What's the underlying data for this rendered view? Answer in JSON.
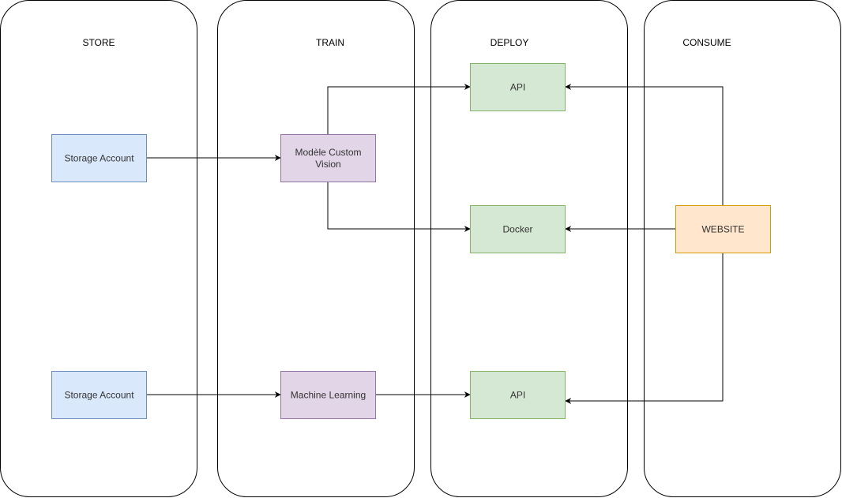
{
  "lanes": [
    {
      "id": "store",
      "label": "STORE"
    },
    {
      "id": "train",
      "label": "TRAIN"
    },
    {
      "id": "deploy",
      "label": "DEPLOY"
    },
    {
      "id": "consume",
      "label": "CONSUME"
    }
  ],
  "nodes": [
    {
      "id": "storage1",
      "label": [
        "Storage Account"
      ],
      "lane": "store",
      "fill": "#dae8fc",
      "stroke": "#6c8ebf"
    },
    {
      "id": "customvision",
      "label": [
        "Modèle Custom",
        "Vision"
      ],
      "lane": "train",
      "fill": "#e1d5e7",
      "stroke": "#9673a6"
    },
    {
      "id": "api1",
      "label": [
        "API"
      ],
      "lane": "deploy",
      "fill": "#d5e8d4",
      "stroke": "#82b366"
    },
    {
      "id": "docker",
      "label": [
        "Docker"
      ],
      "lane": "deploy",
      "fill": "#d5e8d4",
      "stroke": "#82b366"
    },
    {
      "id": "website",
      "label": [
        "WEBSITE"
      ],
      "lane": "consume",
      "fill": "#ffe6cc",
      "stroke": "#d79b00"
    },
    {
      "id": "storage2",
      "label": [
        "Storage Account"
      ],
      "lane": "store",
      "fill": "#dae8fc",
      "stroke": "#6c8ebf"
    },
    {
      "id": "ml",
      "label": [
        "Machine Learning"
      ],
      "lane": "train",
      "fill": "#e1d5e7",
      "stroke": "#9673a6"
    },
    {
      "id": "api2",
      "label": [
        "API"
      ],
      "lane": "deploy",
      "fill": "#d5e8d4",
      "stroke": "#82b366"
    }
  ],
  "edges": [
    {
      "from": "storage1",
      "to": "customvision"
    },
    {
      "from": "customvision",
      "to": "api1"
    },
    {
      "from": "customvision",
      "to": "docker"
    },
    {
      "from": "website",
      "to": "api1"
    },
    {
      "from": "website",
      "to": "docker"
    },
    {
      "from": "website",
      "to": "api2"
    },
    {
      "from": "storage2",
      "to": "ml"
    },
    {
      "from": "ml",
      "to": "api2"
    }
  ]
}
